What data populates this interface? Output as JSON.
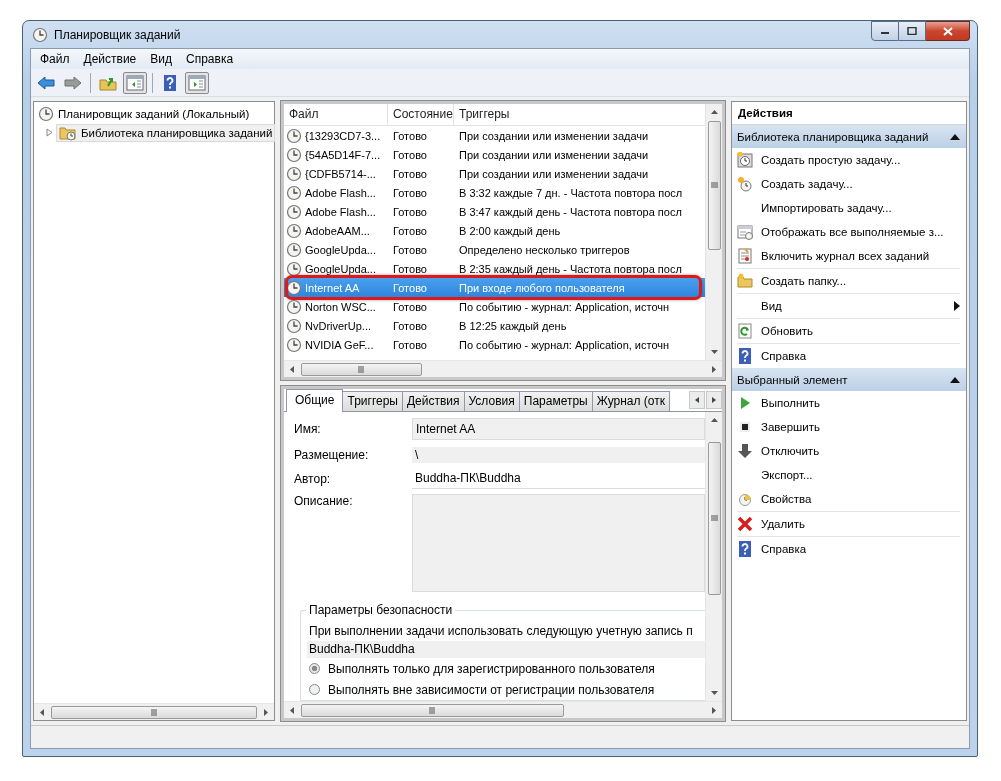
{
  "window": {
    "title": "Планировщик заданий"
  },
  "menu": [
    "Файл",
    "Действие",
    "Вид",
    "Справка"
  ],
  "tree": [
    {
      "label": "Планировщик заданий (Локальный)",
      "selected": false,
      "children": [
        {
          "label": "Библиотека планировщика заданий",
          "expanded": false,
          "selected": true
        }
      ]
    }
  ],
  "task_list": {
    "columns": [
      "Файл",
      "Состояние",
      "Триггеры"
    ],
    "rows": [
      {
        "name": "{13293CD7-3...",
        "status": "Готово",
        "trigger": "При создании или изменении задачи",
        "selected": false,
        "circled": false
      },
      {
        "name": "{54A5D14F-7...",
        "status": "Готово",
        "trigger": "При создании или изменении задачи",
        "selected": false,
        "circled": false
      },
      {
        "name": "{CDFB5714-...",
        "status": "Готово",
        "trigger": "При создании или изменении задачи",
        "selected": false,
        "circled": false
      },
      {
        "name": "Adobe Flash...",
        "status": "Готово",
        "trigger": "В 3:32 каждые 7 дн. - Частота повтора посл",
        "selected": false,
        "circled": false
      },
      {
        "name": "Adobe Flash...",
        "status": "Готово",
        "trigger": "В 3:47 каждый день - Частота повтора посл",
        "selected": false,
        "circled": false
      },
      {
        "name": "AdobeAAM...",
        "status": "Готово",
        "trigger": "В 2:00 каждый день",
        "selected": false,
        "circled": false
      },
      {
        "name": "GoogleUpda...",
        "status": "Готово",
        "trigger": "Определено несколько триггеров",
        "selected": false,
        "circled": false
      },
      {
        "name": "GoogleUpda...",
        "status": "Готово",
        "trigger": "В 2:35 каждый день - Частота повтора посл",
        "selected": false,
        "circled": false
      },
      {
        "name": "Internet AA",
        "status": "Готово",
        "trigger": "При входе любого пользователя",
        "selected": true,
        "circled": true
      },
      {
        "name": "Norton WSC...",
        "status": "Готово",
        "trigger": "По событию - журнал: Application, источн",
        "selected": false,
        "circled": false
      },
      {
        "name": "NvDriverUp...",
        "status": "Готово",
        "trigger": "В 12:25 каждый день",
        "selected": false,
        "circled": false
      },
      {
        "name": "NVIDIA GeF...",
        "status": "Готово",
        "trigger": "По событию - журнал: Application, источн",
        "selected": false,
        "circled": false
      }
    ]
  },
  "detail_tabs": [
    {
      "label": "Общие",
      "selected": true
    },
    {
      "label": "Триггеры",
      "selected": false
    },
    {
      "label": "Действия",
      "selected": false
    },
    {
      "label": "Условия",
      "selected": false
    },
    {
      "label": "Параметры",
      "selected": false
    },
    {
      "label": "Журнал (отк",
      "selected": false
    }
  ],
  "general": {
    "name_label": "Имя:",
    "name_value": "Internet AA",
    "location_label": "Размещение:",
    "location_value": "\\",
    "author_label": "Автор:",
    "author_value": "Buddha-ПК\\Buddha",
    "description_label": "Описание:",
    "security": {
      "legend": "Параметры безопасности",
      "account_prompt": "При выполнении задачи использовать следующую учетную запись п",
      "account": "Buddha-ПК\\Buddha",
      "options": [
        {
          "label": "Выполнять только для зарегистрированного пользователя",
          "selected": true
        },
        {
          "label": "Выполнять вне зависимости от регистрации пользователя",
          "selected": false
        }
      ]
    }
  },
  "actions": {
    "title": "Действия",
    "groups": [
      {
        "title": "Библиотека планировщика заданий",
        "expanded": true,
        "items": [
          {
            "label": "Создать простую задачу...",
            "separator_after": false,
            "submenu": false
          },
          {
            "label": "Создать задачу...",
            "separator_after": false,
            "submenu": false
          },
          {
            "label": "Импортировать задачу...",
            "separator_after": false,
            "submenu": false
          },
          {
            "label": "Отображать все выполняемые з...",
            "separator_after": false,
            "submenu": false
          },
          {
            "label": "Включить журнал всех заданий",
            "separator_after": true,
            "submenu": false
          },
          {
            "label": "Создать папку...",
            "separator_after": true,
            "submenu": false
          },
          {
            "label": "Вид",
            "separator_after": true,
            "submenu": true
          },
          {
            "label": "Обновить",
            "separator_after": true,
            "submenu": false
          },
          {
            "label": "Справка",
            "separator_after": false,
            "submenu": false
          }
        ]
      },
      {
        "title": "Выбранный элемент",
        "expanded": true,
        "items": [
          {
            "label": "Выполнить",
            "separator_after": false,
            "submenu": false
          },
          {
            "label": "Завершить",
            "separator_after": false,
            "submenu": false
          },
          {
            "label": "Отключить",
            "separator_after": false,
            "submenu": false
          },
          {
            "label": "Экспорт...",
            "separator_after": false,
            "submenu": false
          },
          {
            "label": "Свойства",
            "separator_after": true,
            "submenu": false
          },
          {
            "label": "Удалить",
            "separator_after": true,
            "submenu": false
          },
          {
            "label": "Справка",
            "separator_after": false,
            "submenu": false
          }
        ]
      }
    ]
  }
}
